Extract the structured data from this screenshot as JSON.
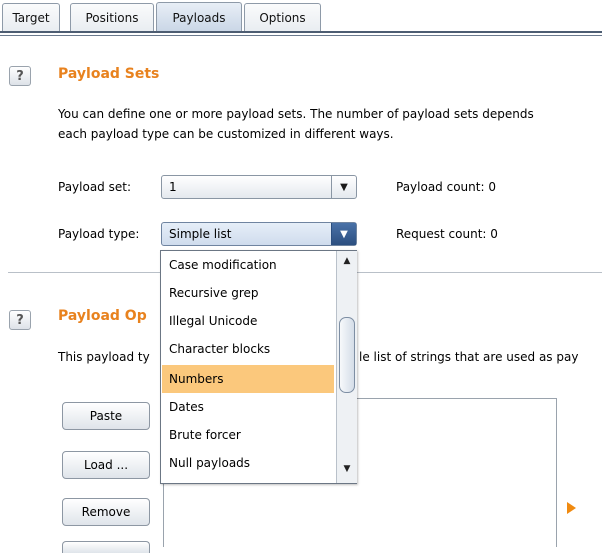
{
  "tabs": [
    {
      "label": "Target"
    },
    {
      "label": "Positions"
    },
    {
      "label": "Payloads",
      "active": true
    },
    {
      "label": "Options"
    }
  ],
  "payload_sets": {
    "help_label": "?",
    "title": "Payload Sets",
    "desc_line1": "You can define one or more payload sets. The number of payload sets depends",
    "desc_line2": "each payload type can be customized in different ways.",
    "set_label": "Payload set:",
    "set_value": "1",
    "count_label": "Payload count:  0",
    "type_label": "Payload type:",
    "type_value": "Simple list",
    "request_label": "Request count:  0"
  },
  "dropdown": {
    "options": [
      "Case modification",
      "Recursive grep",
      "Illegal Unicode",
      "Character blocks",
      "Numbers",
      "Dates",
      "Brute forcer",
      "Null payloads"
    ],
    "highlighted": "Numbers"
  },
  "payload_options": {
    "help_label": "?",
    "title": "Payload Op",
    "desc_left": "This payload ty",
    "desc_right": "le list of strings that are used as pay",
    "buttons": {
      "paste": "Paste",
      "load": "Load ...",
      "remove": "Remove"
    }
  },
  "colors": {
    "section_title": "#e8821e",
    "highlight": "#fbc87c",
    "play_arrow": "#f08a10"
  },
  "icons": {
    "combo_arrow": "chevron-down-icon",
    "help": "help-icon",
    "start": "play-arrow-icon"
  }
}
